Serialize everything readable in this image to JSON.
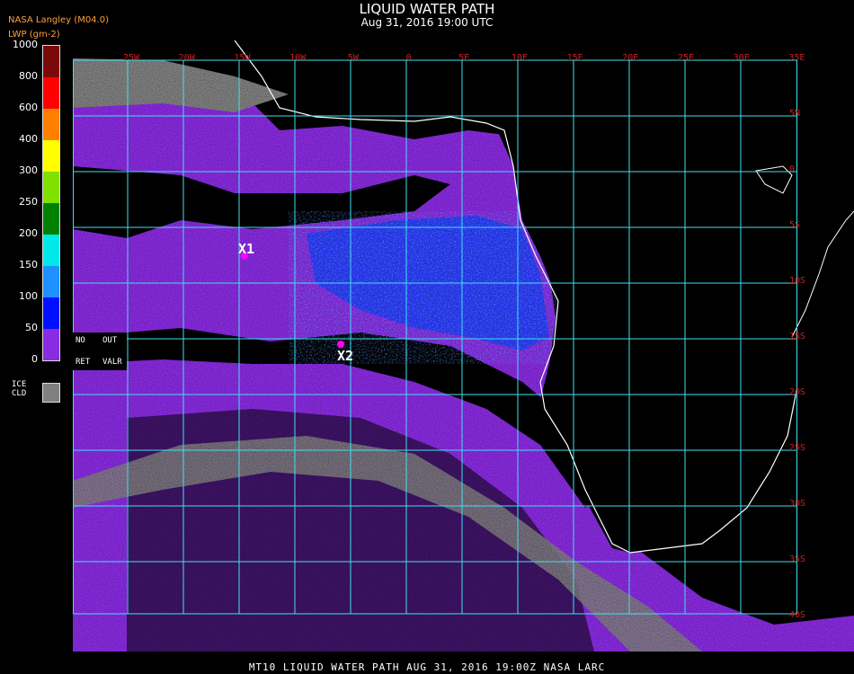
{
  "header": {
    "title": "LIQUID WATER PATH",
    "subtitle": "Aug 31, 2016 19:00 UTC",
    "org": "NASA Langley (M04.0)",
    "unit": "LWP (gm-2)"
  },
  "legend": {
    "ticks": [
      "1000",
      "800",
      "600",
      "400",
      "300",
      "250",
      "200",
      "150",
      "100",
      "50",
      "0"
    ],
    "colors": [
      "#7a0a0a",
      "#ff0000",
      "#ff7f00",
      "#ffff00",
      "#80e000",
      "#008000",
      "#00e8e8",
      "#1e90ff",
      "#0010ff",
      "#8a2be2"
    ],
    "special": {
      "no": "NO",
      "out": "OUT",
      "ret": "RET",
      "valr": "VALR"
    },
    "ice": {
      "line1": "ICE",
      "line2": "CLD",
      "color": "#808080"
    }
  },
  "map": {
    "lon_labels": [
      "25W",
      "20W",
      "15W",
      "10W",
      "5W",
      "0",
      "5E",
      "10E",
      "15E",
      "20E",
      "25E",
      "30E",
      "35E"
    ],
    "lat_labels": [
      "5N",
      "0",
      "5S",
      "10S",
      "15S",
      "20S",
      "25S",
      "30S",
      "35S",
      "40S"
    ],
    "markers": [
      {
        "label": "X1"
      },
      {
        "label": "X2"
      }
    ],
    "grid_color": "#40e0f0",
    "coast_color": "#ffffff",
    "ocean_cloud_color": "#8a2be2",
    "clear_color": "#000000",
    "ice_color": "#808080"
  },
  "footer": "MT10  LIQUID WATER PATH   AUG 31, 2016 19:00Z   NASA LARC"
}
